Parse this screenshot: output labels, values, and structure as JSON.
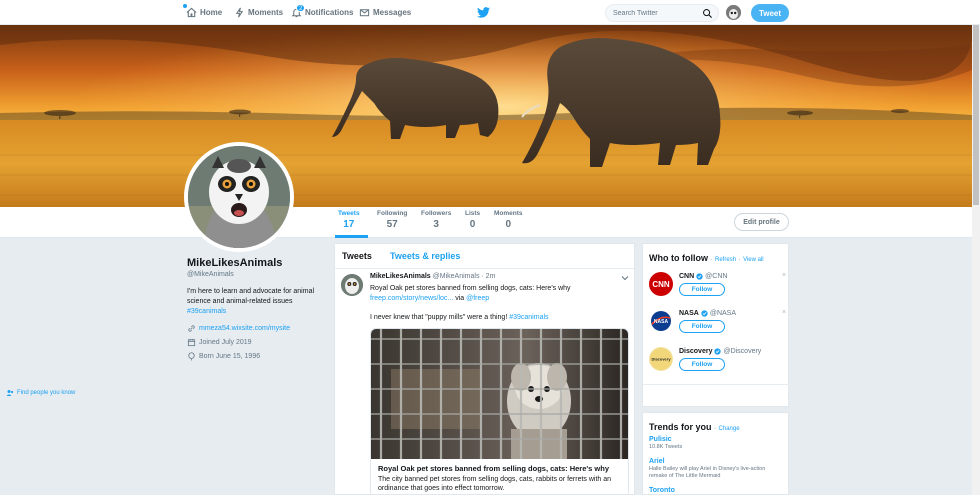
{
  "nav": {
    "home": "Home",
    "moments": "Moments",
    "notifications": "Notifications",
    "notifications_badge": "2",
    "messages": "Messages",
    "search_placeholder": "Search Twitter",
    "tweet_button": "Tweet"
  },
  "profile_nav": {
    "stats": [
      {
        "label": "Tweets",
        "value": "17"
      },
      {
        "label": "Following",
        "value": "57"
      },
      {
        "label": "Followers",
        "value": "3"
      },
      {
        "label": "Lists",
        "value": "0"
      },
      {
        "label": "Moments",
        "value": "0"
      }
    ],
    "edit_profile": "Edit profile"
  },
  "profile": {
    "name": "MikeLikesAnimals",
    "handle": "@MikeAnimals",
    "bio": "I'm here to learn and advocate for animal science and animal-related issues",
    "bio_tag": "#39canimals",
    "website": "mmeza54.wixsite.com/mysite",
    "joined": "Joined July 2019",
    "born": "Born June 15, 1996"
  },
  "timeline": {
    "tab_tweets": "Tweets",
    "tab_replies": "Tweets & replies",
    "tweet": {
      "name": "MikeLikesAnimals",
      "handle": "@MikeAnimals",
      "time": "· 2m",
      "text": "Royal Oak pet stores banned from selling dogs, cats: Here's why",
      "link": "freep.com/story/news/loc...",
      "via": "via",
      "via_handle": "@freep",
      "comment": "I never knew that \"puppy mills\" were a thing!",
      "comment_tag": "#39canimals",
      "card_title": "Royal Oak pet stores banned from selling dogs, cats: Here's why",
      "card_desc": "The city banned pet stores from selling dogs, cats, rabbits or ferrets with an ordinance that goes into effect tomorrow."
    }
  },
  "who_to_follow": {
    "title": "Who to follow",
    "refresh": "Refresh",
    "view_all": "View all",
    "separator": "·",
    "follow_label": "Follow",
    "dismiss": "×",
    "accounts": [
      {
        "name": "CNN",
        "handle": "@CNN",
        "logo_text": "CNN"
      },
      {
        "name": "NASA",
        "handle": "@NASA",
        "logo_text": "NASA"
      },
      {
        "name": "Discovery",
        "handle": "@Discovery",
        "logo_text": "Discovery"
      }
    ],
    "find_people": "Find people you know"
  },
  "trends": {
    "title": "Trends for you",
    "change": "Change",
    "items": [
      {
        "topic": "Pulisic",
        "meta": "10.8K Tweets"
      },
      {
        "topic": "Ariel",
        "meta": "Halle Bailey will play Ariel in Disney's live-action remake of The Little Mermaid"
      },
      {
        "topic": "Toronto",
        "meta": ""
      }
    ]
  },
  "colors": {
    "accent": "#1da1f2",
    "background": "#e6ecf0",
    "cnn": "#cc0000",
    "nasa": "#0b3d91"
  }
}
